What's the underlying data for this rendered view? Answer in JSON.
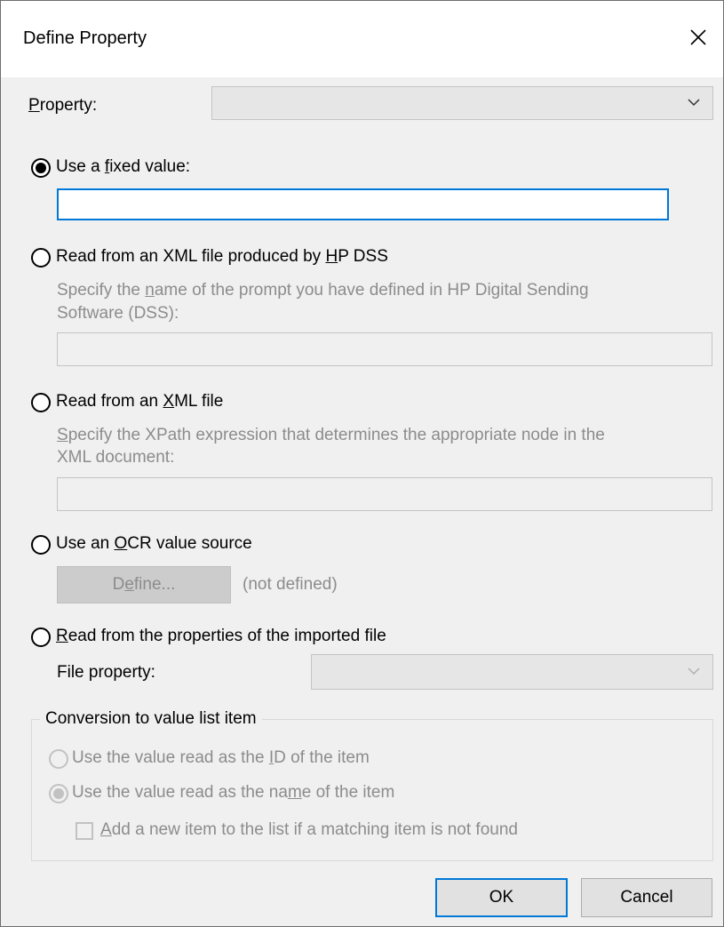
{
  "dialog": {
    "title": "Define Property",
    "close_icon": "close-icon"
  },
  "property": {
    "label_pre": "",
    "label_ul": "P",
    "label_post": "roperty:",
    "value": ""
  },
  "options": {
    "fixed": {
      "pre": "Use a ",
      "ul": "f",
      "post": "ixed value:",
      "value": "",
      "checked": true
    },
    "hp_dss": {
      "pre": "Read from an XML file produced by ",
      "ul": "H",
      "post": "P DSS",
      "checked": false,
      "hint_pre": "Specify the ",
      "hint_ul": "n",
      "hint_post": "ame of the prompt you have defined in HP Digital Sending",
      "hint_line2": "Software (DSS):",
      "value": ""
    },
    "xml": {
      "pre": "Read from an ",
      "ul": "X",
      "post": "ML file",
      "checked": false,
      "hint_pre": "",
      "hint_ul": "S",
      "hint_post": "pecify the XPath expression that determines the appropriate node in the",
      "hint_line2": "XML document:",
      "value": ""
    },
    "ocr": {
      "pre": "Use an ",
      "ul": "O",
      "post": "CR value source",
      "checked": false,
      "define_pre": "D",
      "define_ul": "e",
      "define_post": "fine...",
      "status": "(not defined)"
    },
    "imported": {
      "pre": "",
      "ul": "R",
      "post": "ead from the properties of the imported file",
      "checked": false,
      "file_property_label": "File property:",
      "file_property_value": ""
    }
  },
  "conversion": {
    "group_title": "Conversion to value list item",
    "use_id": {
      "pre": "Use the value read as the ",
      "ul": "I",
      "post": "D of the item",
      "checked": false
    },
    "use_name": {
      "pre": "Use the value read as the na",
      "ul": "m",
      "post": "e of the item",
      "checked": true
    },
    "add_new": {
      "pre": "",
      "ul": "A",
      "post": "dd a new item to the list if a matching item is not found",
      "checked": false
    }
  },
  "buttons": {
    "ok": "OK",
    "cancel": "Cancel"
  },
  "colors": {
    "accent": "#0078d7",
    "disabled_text": "#8c8c8c",
    "dialog_bg": "#f0f0f0"
  }
}
